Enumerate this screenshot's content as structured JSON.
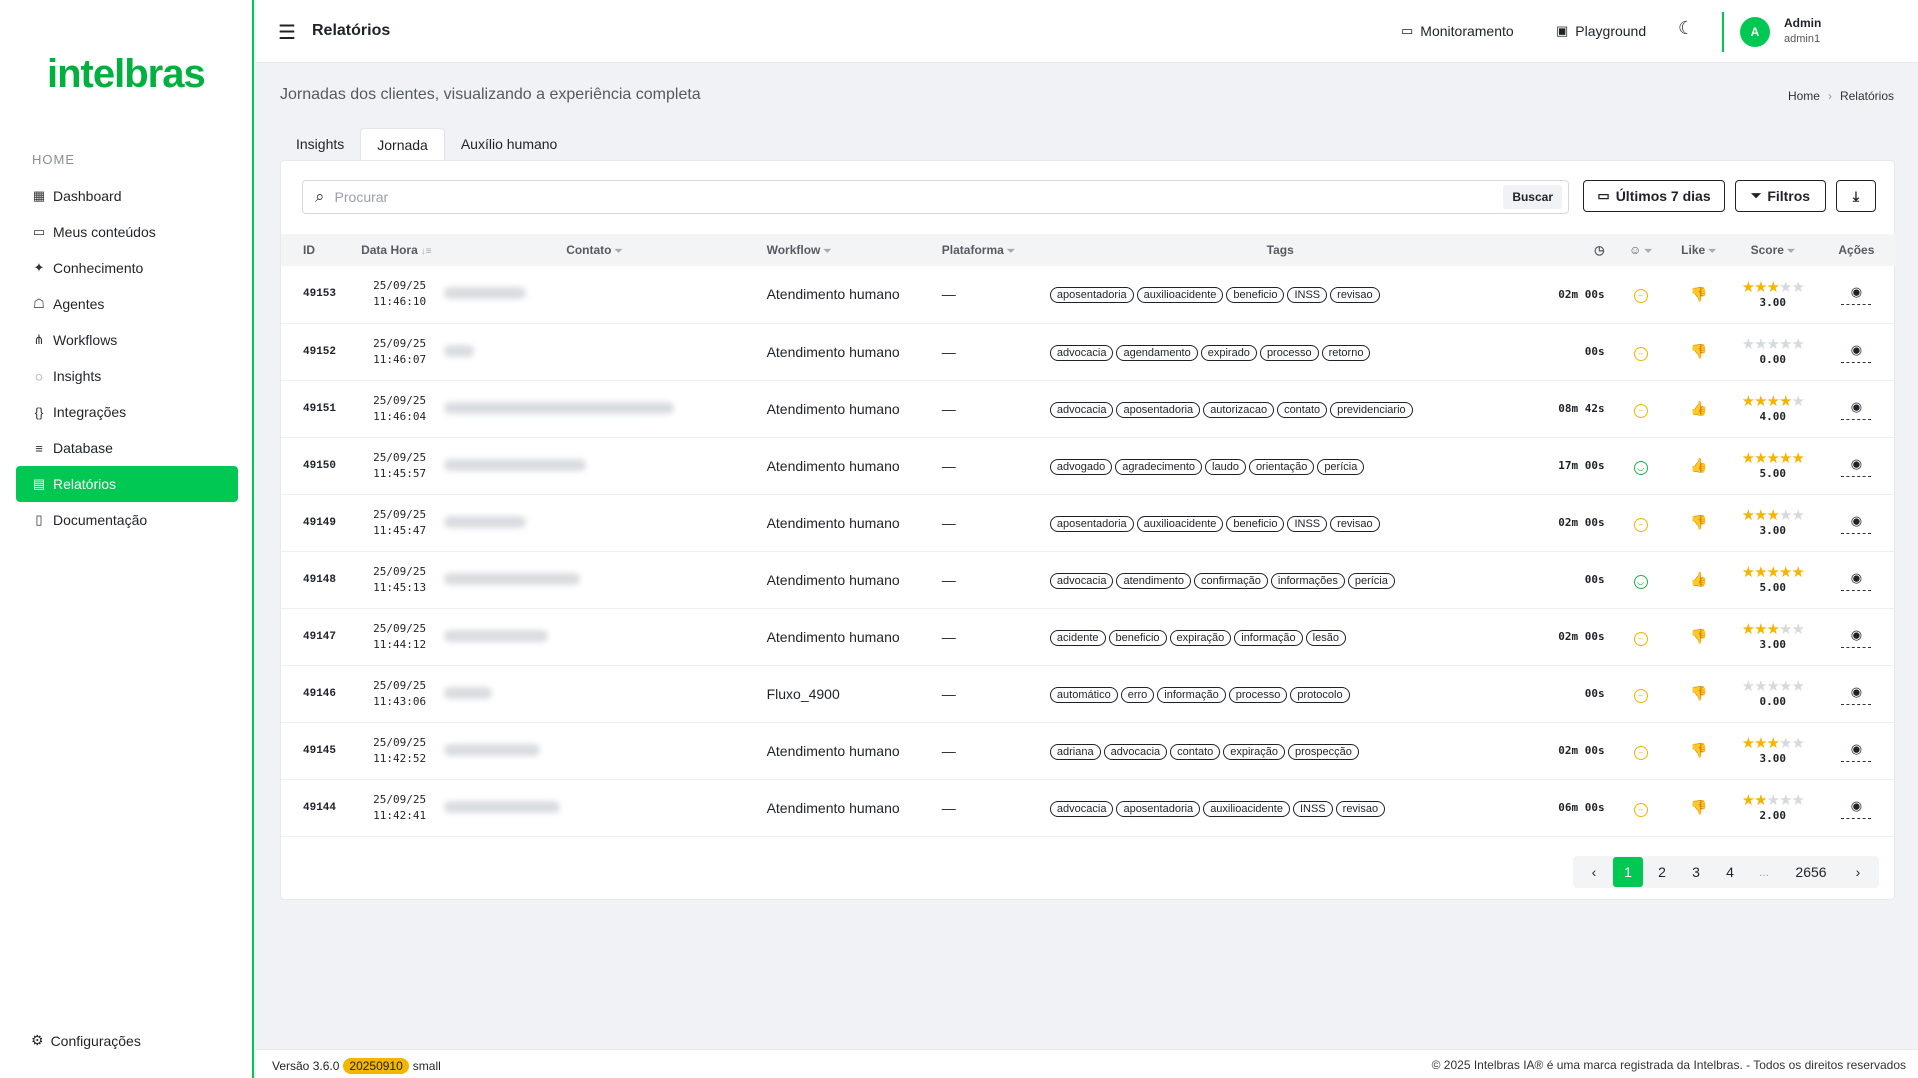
{
  "brand": {
    "logo": "intelbras",
    "accent": "#00c853"
  },
  "sidebar": {
    "heading": "HOME",
    "items": [
      {
        "label": "Dashboard",
        "icon": "grid-icon"
      },
      {
        "label": "Meus conteúdos",
        "icon": "folder-icon"
      },
      {
        "label": "Conhecimento",
        "icon": "sparkle-icon"
      },
      {
        "label": "Agentes",
        "icon": "robot-icon"
      },
      {
        "label": "Workflows",
        "icon": "flow-icon"
      },
      {
        "label": "Insights",
        "icon": "bulb-icon"
      },
      {
        "label": "Integrações",
        "icon": "braces-icon"
      },
      {
        "label": "Database",
        "icon": "database-icon"
      },
      {
        "label": "Relatórios",
        "icon": "report-icon",
        "active": true
      },
      {
        "label": "Documentação",
        "icon": "book-icon"
      }
    ],
    "settings": "Configurações"
  },
  "topbar": {
    "title": "Relatórios",
    "monitor": "Monitoramento",
    "playground": "Playground",
    "user_name": "Admin",
    "user_login": "admin1",
    "avatar": "A"
  },
  "page": {
    "subtitle": "Jornadas dos clientes, visualizando a experiência completa",
    "breadcrumb": [
      "Home",
      "Relatórios"
    ],
    "tabs": [
      "Insights",
      "Jornada",
      "Auxílio humano"
    ],
    "active_tab": "Jornada"
  },
  "toolbar": {
    "search_placeholder": "Procurar",
    "search_button": "Buscar",
    "date_button": "Últimos 7 dias",
    "filter_button": "Filtros"
  },
  "table": {
    "headers": {
      "id": "ID",
      "datetime": "Data Hora",
      "contact": "Contato",
      "workflow": "Workflow",
      "platform": "Plataforma",
      "tags": "Tags",
      "like": "Like",
      "score": "Score",
      "actions": "Ações"
    },
    "rows": [
      {
        "id": "49153",
        "date": "25/09/25",
        "time": "11:46:10",
        "workflow": "Atendimento humano",
        "platform": "—",
        "tags": [
          "aposentadoria",
          "auxilioacidente",
          "beneficio",
          "INSS",
          "revisao"
        ],
        "duration": "02m 00s",
        "sentiment": "neutral",
        "like": "down",
        "stars": 3,
        "score": "3.00"
      },
      {
        "id": "49152",
        "date": "25/09/25",
        "time": "11:46:07",
        "workflow": "Atendimento humano",
        "platform": "—",
        "tags": [
          "advocacia",
          "agendamento",
          "expirado",
          "processo",
          "retorno"
        ],
        "duration": "00s",
        "sentiment": "neutral",
        "like": "down",
        "stars": 0,
        "score": "0.00"
      },
      {
        "id": "49151",
        "date": "25/09/25",
        "time": "11:46:04",
        "workflow": "Atendimento humano",
        "platform": "—",
        "tags": [
          "advocacia",
          "aposentadoria",
          "autorizacao",
          "contato",
          "previdenciario"
        ],
        "duration": "08m 42s",
        "sentiment": "neutral",
        "like": "up",
        "stars": 4,
        "score": "4.00"
      },
      {
        "id": "49150",
        "date": "25/09/25",
        "time": "11:45:57",
        "workflow": "Atendimento humano",
        "platform": "—",
        "tags": [
          "advogado",
          "agradecimento",
          "laudo",
          "orientação",
          "perícia"
        ],
        "duration": "17m 00s",
        "sentiment": "happy",
        "like": "up",
        "stars": 5,
        "score": "5.00"
      },
      {
        "id": "49149",
        "date": "25/09/25",
        "time": "11:45:47",
        "workflow": "Atendimento humano",
        "platform": "—",
        "tags": [
          "aposentadoria",
          "auxilioacidente",
          "beneficio",
          "INSS",
          "revisao"
        ],
        "duration": "02m 00s",
        "sentiment": "neutral",
        "like": "down",
        "stars": 3,
        "score": "3.00"
      },
      {
        "id": "49148",
        "date": "25/09/25",
        "time": "11:45:13",
        "workflow": "Atendimento humano",
        "platform": "—",
        "tags": [
          "advocacia",
          "atendimento",
          "confirmação",
          "informações",
          "perícia"
        ],
        "duration": "00s",
        "sentiment": "happy",
        "like": "up",
        "stars": 5,
        "score": "5.00"
      },
      {
        "id": "49147",
        "date": "25/09/25",
        "time": "11:44:12",
        "workflow": "Atendimento humano",
        "platform": "—",
        "tags": [
          "acidente",
          "beneficio",
          "expiração",
          "informação",
          "lesão"
        ],
        "duration": "02m 00s",
        "sentiment": "neutral",
        "like": "down",
        "stars": 3,
        "score": "3.00"
      },
      {
        "id": "49146",
        "date": "25/09/25",
        "time": "11:43:06",
        "workflow": "Fluxo_4900",
        "platform": "—",
        "tags": [
          "automático",
          "erro",
          "informação",
          "processo",
          "protocolo"
        ],
        "duration": "00s",
        "sentiment": "neutral",
        "like": "down",
        "stars": 0,
        "score": "0.00"
      },
      {
        "id": "49145",
        "date": "25/09/25",
        "time": "11:42:52",
        "workflow": "Atendimento humano",
        "platform": "—",
        "tags": [
          "adriana",
          "advocacia",
          "contato",
          "expiração",
          "prospecção"
        ],
        "duration": "02m 00s",
        "sentiment": "neutral",
        "like": "down",
        "stars": 3,
        "score": "3.00"
      },
      {
        "id": "49144",
        "date": "25/09/25",
        "time": "11:42:41",
        "workflow": "Atendimento humano",
        "platform": "—",
        "tags": [
          "advocacia",
          "aposentadoria",
          "auxilioacidente",
          "INSS",
          "revisao"
        ],
        "duration": "06m 00s",
        "sentiment": "neutral",
        "like": "down",
        "stars": 2,
        "score": "2.00"
      }
    ]
  },
  "pagination": {
    "pages": [
      "1",
      "2",
      "3",
      "4"
    ],
    "ellipsis": "...",
    "last": "2656",
    "current": "1"
  },
  "footer": {
    "version_label": "Versão 3.6.0",
    "build": "20250910",
    "size": "small",
    "copyright": "© 2025 Intelbras IA® é uma marca registrada da Intelbras. - Todos os direitos reservados"
  },
  "colors": {
    "like_up": "#22b14c",
    "like_down": "#e53935",
    "star": "#f4b400",
    "badge": "#f4b400"
  }
}
